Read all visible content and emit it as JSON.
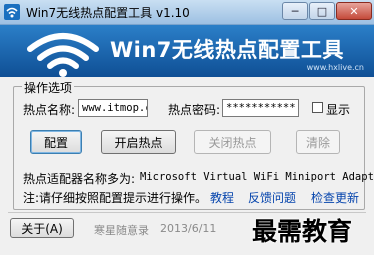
{
  "window": {
    "title": "Win7无线热点配置工具 v1.10",
    "min_glyph": "─",
    "max_glyph": "□",
    "close_glyph": "✕"
  },
  "banner": {
    "title": "Win7无线热点配置工具",
    "url": "www.hxlive.cn"
  },
  "group": {
    "label": "操作选项"
  },
  "hotspot": {
    "name_label": "热点名称:",
    "name_value": "www.itmop.cc",
    "password_label": "热点密码:",
    "password_value": "***********",
    "show_label": "显示",
    "show_checked": false
  },
  "buttons": {
    "configure": "配置",
    "start": "开启热点",
    "stop": "关闭热点",
    "clear": "清除"
  },
  "adapter": {
    "label": "热点适配器名称多为:",
    "name": "Microsoft Virtual WiFi Miniport Adapter"
  },
  "note": {
    "text": "注:请仔细按照配置提示进行操作。",
    "links": [
      "教程",
      "反馈问题",
      "检查更新"
    ]
  },
  "footer": {
    "about": "关于(A)",
    "author": "寒星随意录",
    "date": "2013/6/11"
  },
  "watermark": "最需教育",
  "colors": {
    "banner_top": "#2b7fc8",
    "banner_bottom": "#0f4f95",
    "link": "#0645ad"
  }
}
